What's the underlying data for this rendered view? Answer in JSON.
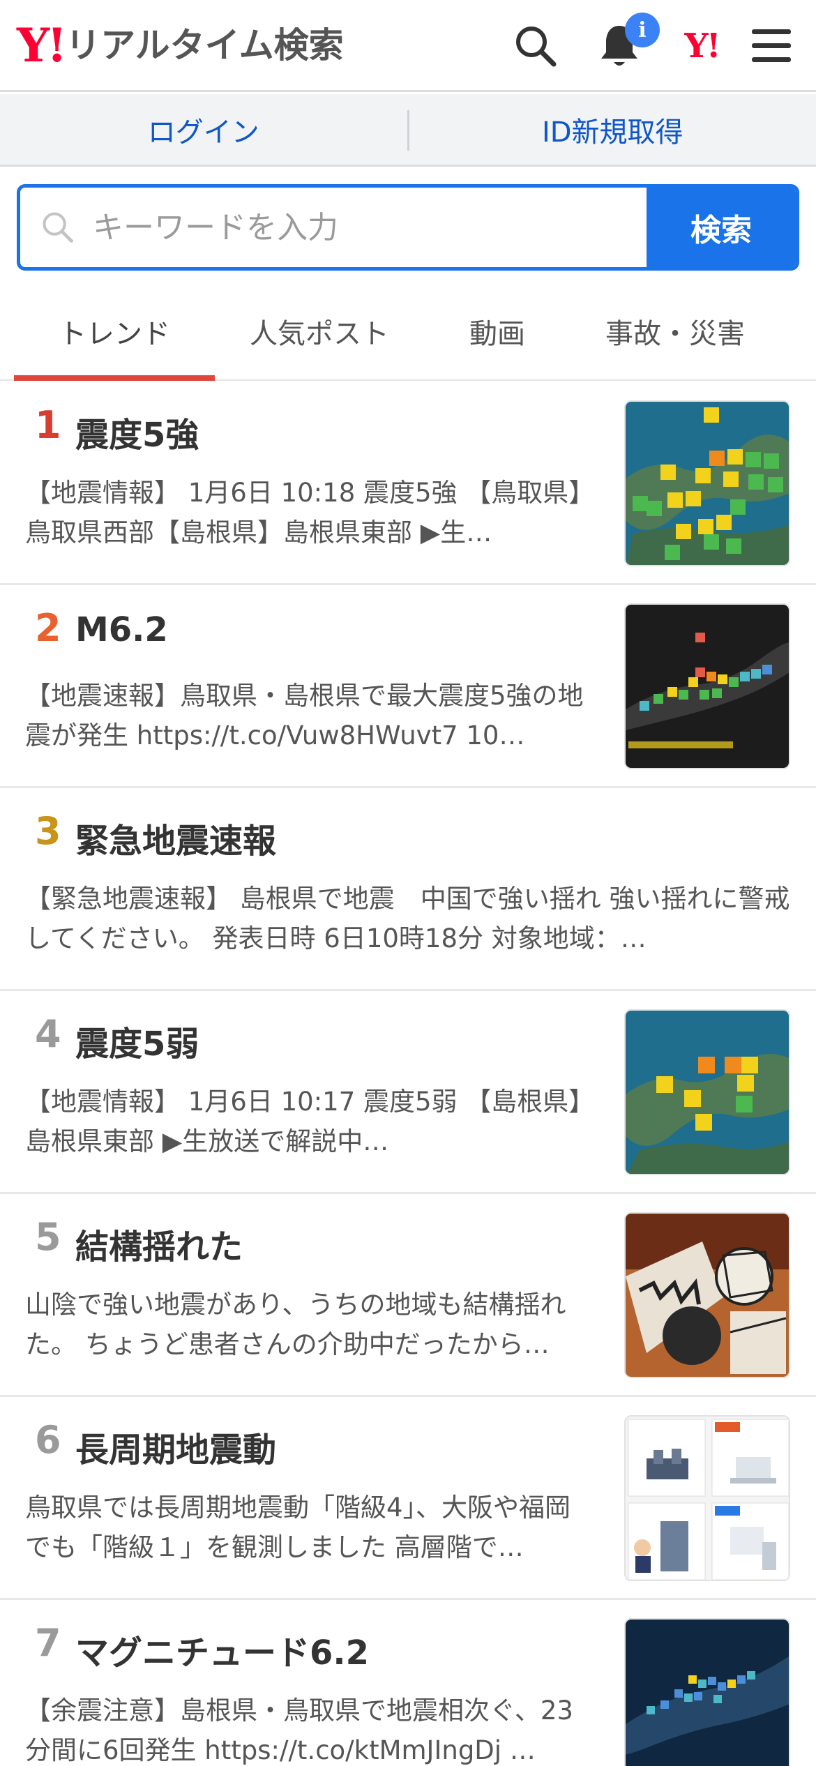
{
  "header": {
    "logo_mark": "Y!",
    "logo_text": "リアルタイム検索",
    "notification_badge": "i",
    "yj_mark": "Y!"
  },
  "account": {
    "login": "ログイン",
    "register": "ID新規取得"
  },
  "search": {
    "placeholder": "キーワードを入力",
    "button": "検索"
  },
  "tabs": [
    {
      "label": "トレンド",
      "active": true
    },
    {
      "label": "人気ポスト",
      "active": false
    },
    {
      "label": "動画",
      "active": false
    },
    {
      "label": "事故・災害",
      "active": false
    }
  ],
  "colors": {
    "accent_blue": "#1a73e8",
    "brand_red": "#ff0033",
    "tab_underline": "#e0463c",
    "rank1": "#d93d2f",
    "rank2": "#e8622e",
    "rank3": "#c8941a",
    "rank_other": "#9a9a9a"
  },
  "trends": [
    {
      "rank": "1",
      "keyword": "震度5強",
      "text": "【地震情報】 1月6日 10:18 震度5強 【鳥取県】鳥取県西部【島根県】島根県東部 ▶生…",
      "thumbnail": "earthquake-map"
    },
    {
      "rank": "2",
      "keyword": "M6.2",
      "text": "【地震速報】鳥取県・島根県で最大震度5強の地震が発生 https://t.co/Vuw8HWuvt7 10…",
      "thumbnail": "earthquake-dark-map"
    },
    {
      "rank": "3",
      "keyword": "緊急地震速報",
      "text": "【緊急地震速報】 島根県で地震　中国で強い揺れ 強い揺れに警戒してください。 発表日時 6日10時18分 対象地域：…",
      "thumbnail": ""
    },
    {
      "rank": "4",
      "keyword": "震度5弱",
      "text": "【地震情報】 1月6日 10:17 震度5弱 【島根県】島根県東部 ▶生放送で解説中…",
      "thumbnail": "earthquake-map"
    },
    {
      "rank": "5",
      "keyword": "結構揺れた",
      "text": "山陰で強い地震があり、うちの地域も結構揺れた。 ちょうど患者さんの介助中だったから…",
      "thumbnail": "manga-illustration"
    },
    {
      "rank": "6",
      "keyword": "長周期地震動",
      "text": "鳥取県では長周期地震動「階級4」、大阪や福岡でも「階級１」を観測しました 高層階で…",
      "thumbnail": "infographic"
    },
    {
      "rank": "7",
      "keyword": "マグニチュード6.2",
      "text": "【余震注意】島根県・鳥取県で地震相次ぐ、23分間に6回発生 https://t.co/ktMmJIngDj …",
      "thumbnail": "earthquake-dark-map"
    }
  ]
}
